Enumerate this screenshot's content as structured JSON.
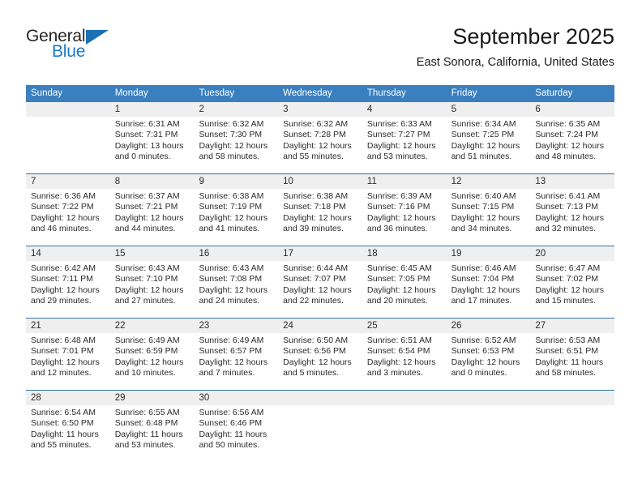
{
  "brand": {
    "name_part1": "General",
    "name_part2": "Blue",
    "triangle_color": "#1b6fb3",
    "blue_color": "#1b7ac4"
  },
  "header": {
    "title": "September 2025",
    "subtitle": "East Sonora, California, United States",
    "header_bg": "#3a7fbe",
    "row_divider": "#2f73ac",
    "daynum_bg": "#efefef"
  },
  "weekdays": [
    "Sunday",
    "Monday",
    "Tuesday",
    "Wednesday",
    "Thursday",
    "Friday",
    "Saturday"
  ],
  "weeks": [
    {
      "days": [
        {
          "num": "",
          "lines": []
        },
        {
          "num": "1",
          "lines": [
            "Sunrise: 6:31 AM",
            "Sunset: 7:31 PM",
            "Daylight: 13 hours",
            "and 0 minutes."
          ]
        },
        {
          "num": "2",
          "lines": [
            "Sunrise: 6:32 AM",
            "Sunset: 7:30 PM",
            "Daylight: 12 hours",
            "and 58 minutes."
          ]
        },
        {
          "num": "3",
          "lines": [
            "Sunrise: 6:32 AM",
            "Sunset: 7:28 PM",
            "Daylight: 12 hours",
            "and 55 minutes."
          ]
        },
        {
          "num": "4",
          "lines": [
            "Sunrise: 6:33 AM",
            "Sunset: 7:27 PM",
            "Daylight: 12 hours",
            "and 53 minutes."
          ]
        },
        {
          "num": "5",
          "lines": [
            "Sunrise: 6:34 AM",
            "Sunset: 7:25 PM",
            "Daylight: 12 hours",
            "and 51 minutes."
          ]
        },
        {
          "num": "6",
          "lines": [
            "Sunrise: 6:35 AM",
            "Sunset: 7:24 PM",
            "Daylight: 12 hours",
            "and 48 minutes."
          ]
        }
      ]
    },
    {
      "days": [
        {
          "num": "7",
          "lines": [
            "Sunrise: 6:36 AM",
            "Sunset: 7:22 PM",
            "Daylight: 12 hours",
            "and 46 minutes."
          ]
        },
        {
          "num": "8",
          "lines": [
            "Sunrise: 6:37 AM",
            "Sunset: 7:21 PM",
            "Daylight: 12 hours",
            "and 44 minutes."
          ]
        },
        {
          "num": "9",
          "lines": [
            "Sunrise: 6:38 AM",
            "Sunset: 7:19 PM",
            "Daylight: 12 hours",
            "and 41 minutes."
          ]
        },
        {
          "num": "10",
          "lines": [
            "Sunrise: 6:38 AM",
            "Sunset: 7:18 PM",
            "Daylight: 12 hours",
            "and 39 minutes."
          ]
        },
        {
          "num": "11",
          "lines": [
            "Sunrise: 6:39 AM",
            "Sunset: 7:16 PM",
            "Daylight: 12 hours",
            "and 36 minutes."
          ]
        },
        {
          "num": "12",
          "lines": [
            "Sunrise: 6:40 AM",
            "Sunset: 7:15 PM",
            "Daylight: 12 hours",
            "and 34 minutes."
          ]
        },
        {
          "num": "13",
          "lines": [
            "Sunrise: 6:41 AM",
            "Sunset: 7:13 PM",
            "Daylight: 12 hours",
            "and 32 minutes."
          ]
        }
      ]
    },
    {
      "days": [
        {
          "num": "14",
          "lines": [
            "Sunrise: 6:42 AM",
            "Sunset: 7:11 PM",
            "Daylight: 12 hours",
            "and 29 minutes."
          ]
        },
        {
          "num": "15",
          "lines": [
            "Sunrise: 6:43 AM",
            "Sunset: 7:10 PM",
            "Daylight: 12 hours",
            "and 27 minutes."
          ]
        },
        {
          "num": "16",
          "lines": [
            "Sunrise: 6:43 AM",
            "Sunset: 7:08 PM",
            "Daylight: 12 hours",
            "and 24 minutes."
          ]
        },
        {
          "num": "17",
          "lines": [
            "Sunrise: 6:44 AM",
            "Sunset: 7:07 PM",
            "Daylight: 12 hours",
            "and 22 minutes."
          ]
        },
        {
          "num": "18",
          "lines": [
            "Sunrise: 6:45 AM",
            "Sunset: 7:05 PM",
            "Daylight: 12 hours",
            "and 20 minutes."
          ]
        },
        {
          "num": "19",
          "lines": [
            "Sunrise: 6:46 AM",
            "Sunset: 7:04 PM",
            "Daylight: 12 hours",
            "and 17 minutes."
          ]
        },
        {
          "num": "20",
          "lines": [
            "Sunrise: 6:47 AM",
            "Sunset: 7:02 PM",
            "Daylight: 12 hours",
            "and 15 minutes."
          ]
        }
      ]
    },
    {
      "days": [
        {
          "num": "21",
          "lines": [
            "Sunrise: 6:48 AM",
            "Sunset: 7:01 PM",
            "Daylight: 12 hours",
            "and 12 minutes."
          ]
        },
        {
          "num": "22",
          "lines": [
            "Sunrise: 6:49 AM",
            "Sunset: 6:59 PM",
            "Daylight: 12 hours",
            "and 10 minutes."
          ]
        },
        {
          "num": "23",
          "lines": [
            "Sunrise: 6:49 AM",
            "Sunset: 6:57 PM",
            "Daylight: 12 hours",
            "and 7 minutes."
          ]
        },
        {
          "num": "24",
          "lines": [
            "Sunrise: 6:50 AM",
            "Sunset: 6:56 PM",
            "Daylight: 12 hours",
            "and 5 minutes."
          ]
        },
        {
          "num": "25",
          "lines": [
            "Sunrise: 6:51 AM",
            "Sunset: 6:54 PM",
            "Daylight: 12 hours",
            "and 3 minutes."
          ]
        },
        {
          "num": "26",
          "lines": [
            "Sunrise: 6:52 AM",
            "Sunset: 6:53 PM",
            "Daylight: 12 hours",
            "and 0 minutes."
          ]
        },
        {
          "num": "27",
          "lines": [
            "Sunrise: 6:53 AM",
            "Sunset: 6:51 PM",
            "Daylight: 11 hours",
            "and 58 minutes."
          ]
        }
      ]
    },
    {
      "days": [
        {
          "num": "28",
          "lines": [
            "Sunrise: 6:54 AM",
            "Sunset: 6:50 PM",
            "Daylight: 11 hours",
            "and 55 minutes."
          ]
        },
        {
          "num": "29",
          "lines": [
            "Sunrise: 6:55 AM",
            "Sunset: 6:48 PM",
            "Daylight: 11 hours",
            "and 53 minutes."
          ]
        },
        {
          "num": "30",
          "lines": [
            "Sunrise: 6:56 AM",
            "Sunset: 6:46 PM",
            "Daylight: 11 hours",
            "and 50 minutes."
          ]
        },
        {
          "num": "",
          "lines": []
        },
        {
          "num": "",
          "lines": []
        },
        {
          "num": "",
          "lines": []
        },
        {
          "num": "",
          "lines": []
        }
      ]
    }
  ]
}
